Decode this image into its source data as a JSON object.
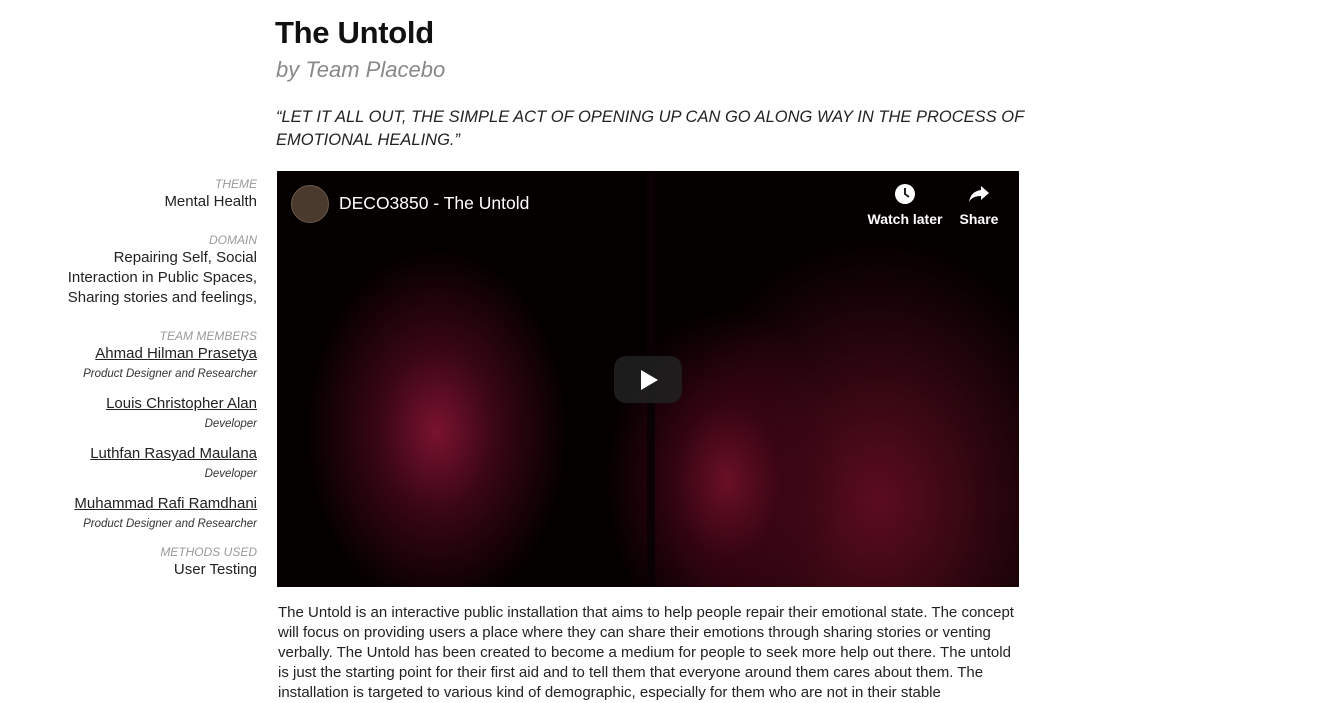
{
  "header": {
    "title": "The Untold",
    "byline": "by Team Placebo",
    "quote": "“LET IT ALL OUT, THE SIMPLE ACT OF OPENING UP CAN GO ALONG WAY IN THE PROCESS OF EMOTIONAL HEALING.”"
  },
  "sidebar": {
    "theme_label": "THEME",
    "theme_value": "Mental Health",
    "domain_label": "DOMAIN",
    "domain_value": "Repairing Self, Social Interaction in Public Spaces, Sharing stories and feelings,",
    "team_label": "TEAM MEMBERS",
    "members": [
      {
        "name": "Ahmad Hilman Prasetya",
        "role": "Product Designer and Researcher"
      },
      {
        "name": "Louis Christopher Alan",
        "role": "Developer"
      },
      {
        "name": "Luthfan Rasyad Maulana",
        "role": "Developer"
      },
      {
        "name": "Muhammad Rafi Ramdhani",
        "role": "Product Designer and Researcher"
      }
    ],
    "methods_label": "METHODS USED",
    "methods_value": "User Testing"
  },
  "video": {
    "title": "DECO3850 - The Untold",
    "watch_later_label": "Watch later",
    "share_label": "Share",
    "clock_icon": "clock-icon",
    "share_icon": "share-arrow-icon",
    "play_icon": "play-icon"
  },
  "description": "The Untold is an interactive public installation that aims to help people repair their emotional state. The concept will focus on providing users a place where they can share their emotions through sharing stories or venting verbally. The Untold has been created to become a medium for people to seek more help out there. The untold is just the starting point for their first aid and to tell them that everyone around them cares about them. The installation is targeted to various kind of demographic, especially for them who are not in their stable"
}
